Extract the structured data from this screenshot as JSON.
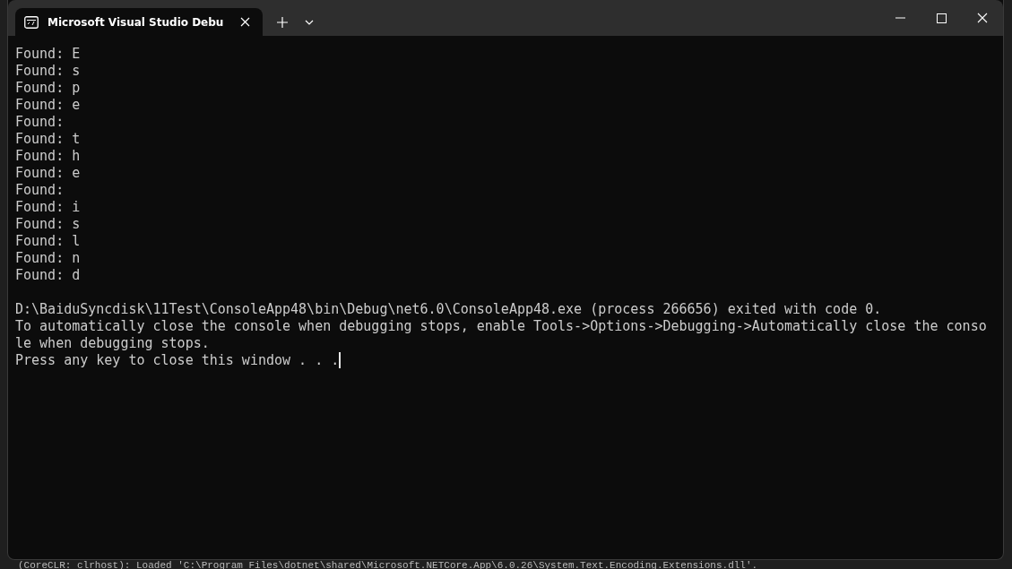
{
  "window": {
    "tab_title": "Microsoft Visual Studio Debu"
  },
  "console": {
    "lines": [
      "Found: E",
      "Found: s",
      "Found: p",
      "Found: e",
      "Found: ",
      "Found: t",
      "Found: h",
      "Found: e",
      "Found: ",
      "Found: i",
      "Found: s",
      "Found: l",
      "Found: n",
      "Found: d"
    ],
    "exit_lines": [
      "D:\\BaiduSyncdisk\\11Test\\ConsoleApp48\\bin\\Debug\\net6.0\\ConsoleApp48.exe (process 266656) exited with code 0.",
      "To automatically close the console when debugging stops, enable Tools->Options->Debugging->Automatically close the conso",
      "le when debugging stops.",
      "Press any key to close this window . . ."
    ],
    "cursor": true
  },
  "background_output": "(CoreCLR: clrhost): Loaded 'C:\\Program Files\\dotnet\\shared\\Microsoft.NETCore.App\\6.0.26\\System.Text.Encoding.Extensions.dll'."
}
